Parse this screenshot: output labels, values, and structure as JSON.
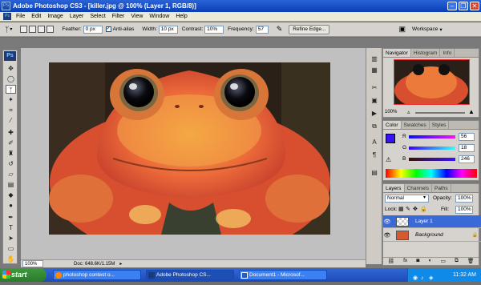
{
  "window": {
    "title": "Adobe Photoshop CS3 - [killer.jpg @ 100% (Layer 1, RGB/8)]"
  },
  "menu": [
    "File",
    "Edit",
    "Image",
    "Layer",
    "Select",
    "Filter",
    "View",
    "Window",
    "Help"
  ],
  "options": {
    "feather_label": "Feather:",
    "feather_value": "0 px",
    "antialias_label": "Anti-alias",
    "width_label": "Width:",
    "width_value": "10 px",
    "contrast_label": "Contrast:",
    "contrast_value": "10%",
    "frequency_label": "Frequency:",
    "frequency_value": "57",
    "refine_edge": "Refine Edge...",
    "workspace": "Workspace"
  },
  "document": {
    "zoom": "100%",
    "doc_size": "Doc: 648.6K/1.15M"
  },
  "navigator": {
    "tabs": [
      "Navigator",
      "Histogram",
      "Info"
    ],
    "zoom": "100%"
  },
  "color": {
    "tabs": [
      "Color",
      "Swatches",
      "Styles"
    ],
    "r_label": "R",
    "g_label": "G",
    "b_label": "B",
    "r": "56",
    "g": "18",
    "b": "246",
    "swatch": "#3812f6"
  },
  "layers": {
    "tabs": [
      "Layers",
      "Channels",
      "Paths"
    ],
    "blend_mode": "Normal",
    "opacity_label": "Opacity:",
    "opacity": "100%",
    "lock_label": "Lock:",
    "fill_label": "Fill:",
    "fill": "100%",
    "items": [
      {
        "name": "Layer 1",
        "selected": true
      },
      {
        "name": "Background",
        "selected": false
      }
    ],
    "footer_icons": [
      "link-icon",
      "fx-icon",
      "mask-icon",
      "adjustment-icon",
      "group-icon",
      "new-layer-icon",
      "trash-icon"
    ]
  },
  "taskbar": {
    "start": "start",
    "tasks": [
      "photoshop contest o...",
      "Adobe Photoshop CS...",
      "Document1 - Microsof..."
    ],
    "clock": "11:32 AM"
  },
  "colors": {
    "accent": "#2a63d8",
    "taskbar": "#245edb",
    "start": "#3a8e3a",
    "selected_layer": "#3a6ad8"
  }
}
